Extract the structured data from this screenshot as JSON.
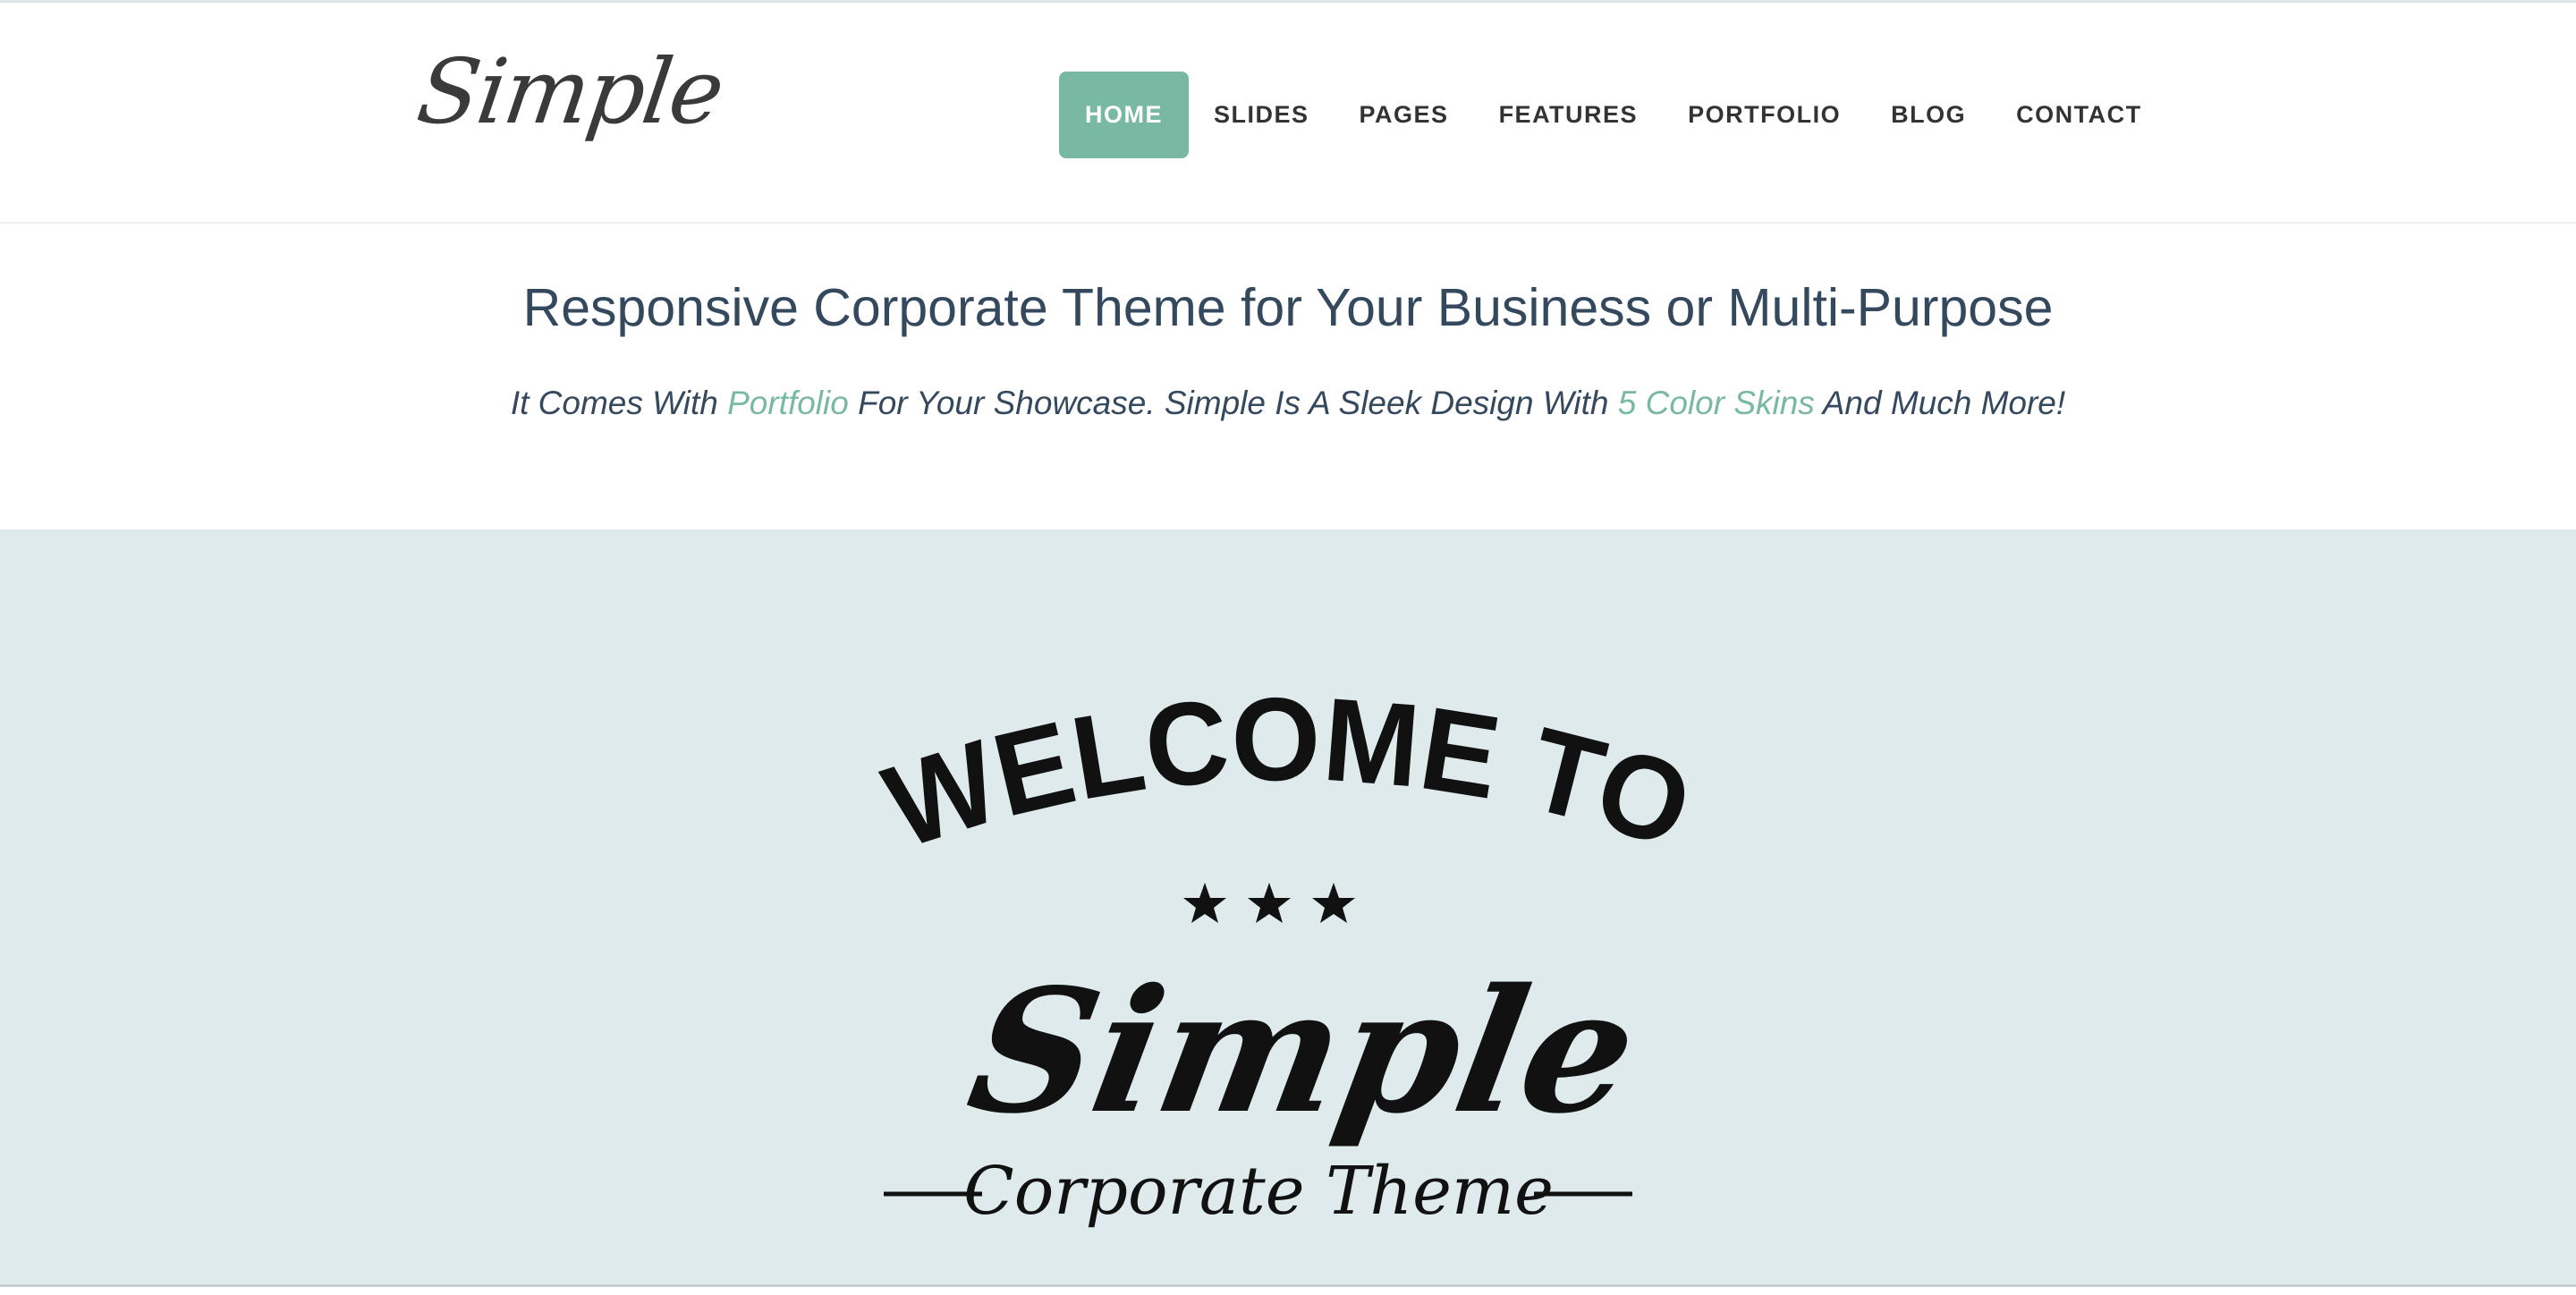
{
  "header": {
    "logo_text": "Simple",
    "nav": [
      {
        "label": "HOME",
        "active": true
      },
      {
        "label": "SLIDES",
        "active": false
      },
      {
        "label": "PAGES",
        "active": false
      },
      {
        "label": "FEATURES",
        "active": false
      },
      {
        "label": "PORTFOLIO",
        "active": false
      },
      {
        "label": "BLOG",
        "active": false
      },
      {
        "label": "CONTACT",
        "active": false
      }
    ]
  },
  "intro": {
    "title": "Responsive Corporate Theme for Your Business or Multi-Purpose",
    "subtitle_part1": "It Comes With ",
    "subtitle_link1": "Portfolio",
    "subtitle_part2": " For Your Showcase. Simple Is A Sleek Design With ",
    "subtitle_link2": "5 Color Skins",
    "subtitle_part3": " And Much More!"
  },
  "hero": {
    "headline": "WELCOME TO",
    "stars": 3,
    "brand": "Simple",
    "tagline": "Corporate Theme",
    "background": "#deeaec"
  },
  "colors": {
    "accent": "#79b8a3",
    "text": "#34495e",
    "nav_text": "#333333"
  },
  "icons": [
    "star-icon"
  ]
}
